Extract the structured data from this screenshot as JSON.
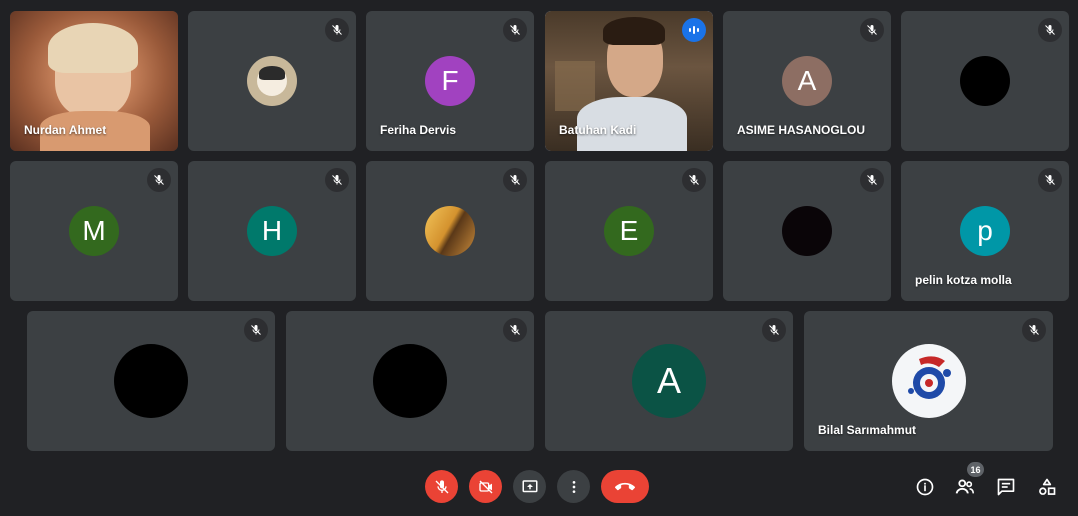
{
  "participants": [
    {
      "name": "Nurdan Ahmet",
      "type": "video"
    },
    {
      "name": "",
      "type": "avatar-image"
    },
    {
      "name": "Feriha Dervis",
      "initial": "F",
      "color": "#a142c0"
    },
    {
      "name": "Batuhan Kadi",
      "type": "video",
      "speaking": true
    },
    {
      "name": "ASIME HASANOGLOU",
      "initial": "A",
      "color": "#8d6e63"
    },
    {
      "name": "",
      "type": "avatar-black"
    },
    {
      "name": "",
      "initial": "M",
      "color": "#33691e"
    },
    {
      "name": "",
      "initial": "H",
      "color": "#00796b"
    },
    {
      "name": "",
      "type": "avatar-image"
    },
    {
      "name": "",
      "initial": "E",
      "color": "#33691e"
    },
    {
      "name": "",
      "type": "avatar-black"
    },
    {
      "name": "pelin kotza molla",
      "initial": "p",
      "color": "#0097a7"
    },
    {
      "name": "",
      "type": "avatar-black"
    },
    {
      "name": "",
      "type": "avatar-black"
    },
    {
      "name": "",
      "initial": "A",
      "color": "#0b5345"
    },
    {
      "name": "Bilal Sarımahmut",
      "type": "avatar-image"
    }
  ],
  "controls": {
    "participant_count": "16"
  },
  "icons": {
    "mic_off": "mic-off-icon",
    "cam_off": "camera-off-icon",
    "present": "present-screen-icon",
    "more": "more-vert-icon",
    "hangup": "end-call-icon",
    "info": "info-icon",
    "people": "people-icon",
    "chat": "chat-icon",
    "activities": "activities-icon"
  }
}
